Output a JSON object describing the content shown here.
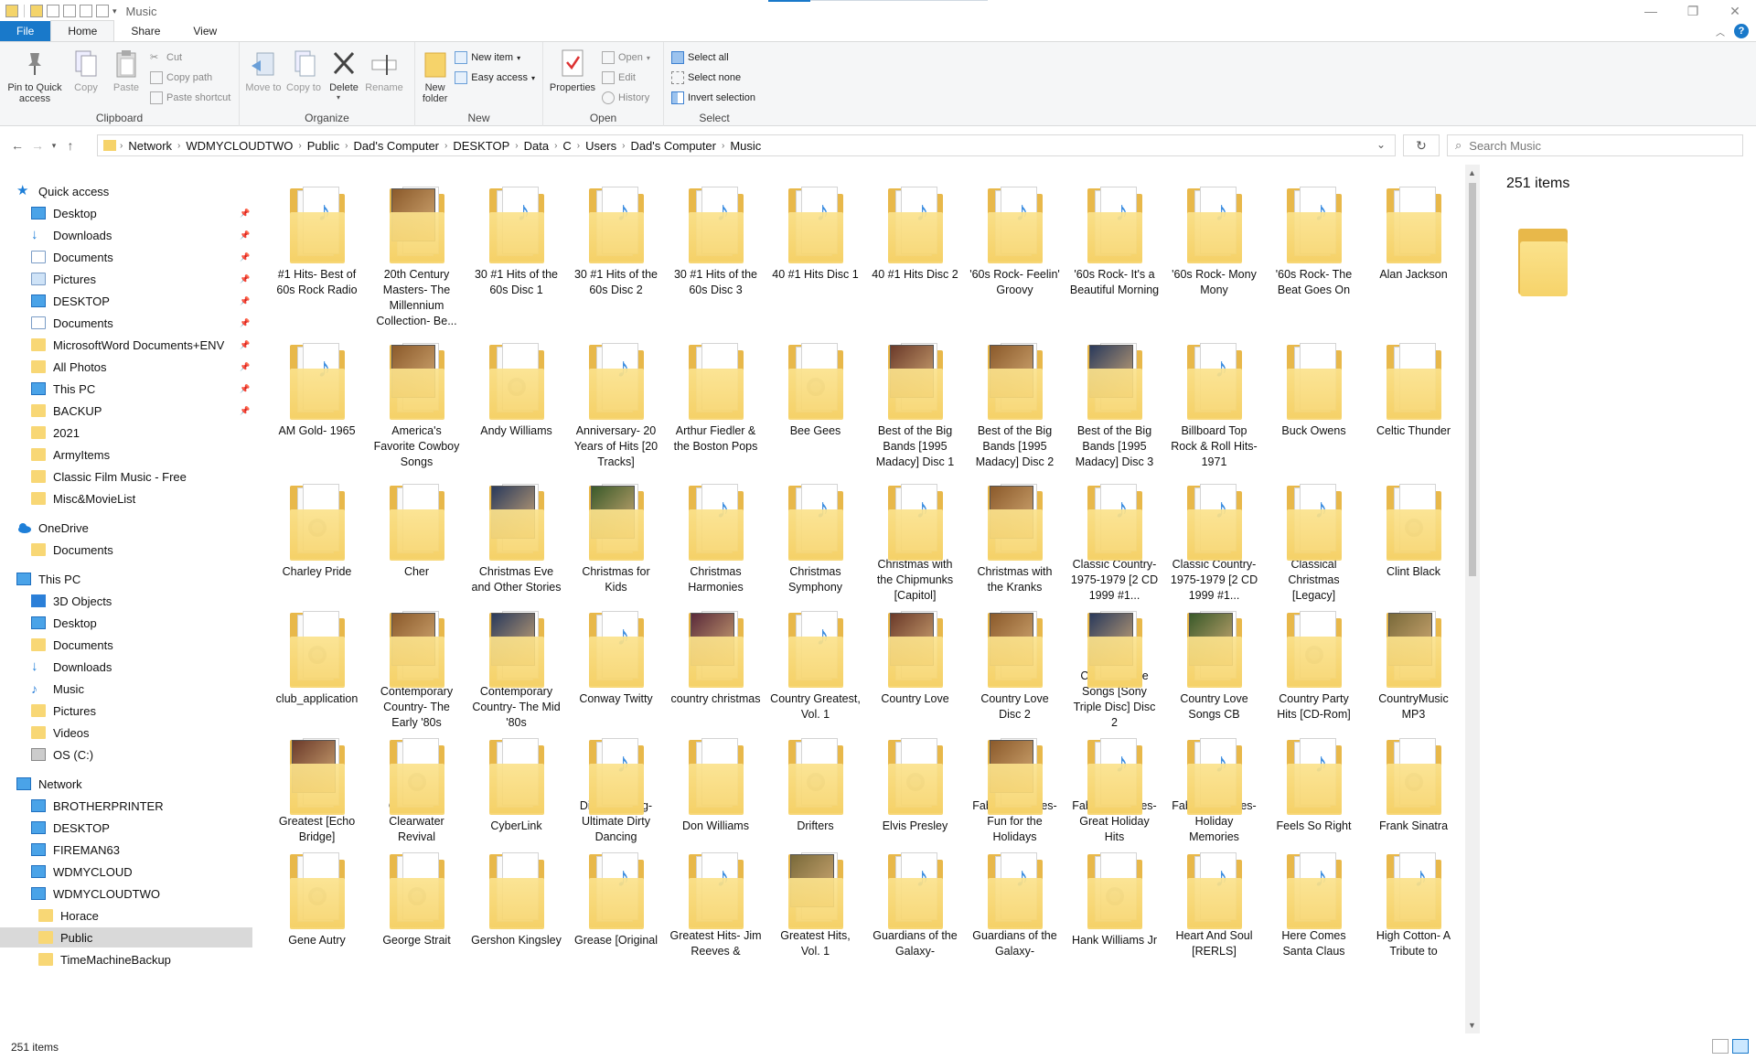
{
  "window": {
    "title": "Music",
    "controls": [
      "—",
      "❐",
      "✕"
    ]
  },
  "ribbon_tabs": [
    "File",
    "Home",
    "Share",
    "View"
  ],
  "ribbon": {
    "clipboard": {
      "label": "Clipboard",
      "pin": "Pin to Quick access",
      "copy": "Copy",
      "paste": "Paste",
      "cut": "Cut",
      "copy_path": "Copy path",
      "paste_shortcut": "Paste shortcut"
    },
    "organize": {
      "label": "Organize",
      "move_to": "Move to",
      "copy_to": "Copy to",
      "delete": "Delete",
      "rename": "Rename"
    },
    "new": {
      "label": "New",
      "new_folder": "New folder",
      "new_item": "New item",
      "easy_access": "Easy access"
    },
    "open": {
      "label": "Open",
      "properties": "Properties",
      "open": "Open",
      "edit": "Edit",
      "history": "History"
    },
    "select": {
      "label": "Select",
      "select_all": "Select all",
      "select_none": "Select none",
      "invert": "Invert selection"
    }
  },
  "address": {
    "crumbs": [
      "Network",
      "WDMYCLOUDTWO",
      "Public",
      "Dad's Computer",
      "DESKTOP",
      "Data",
      "C",
      "Users",
      "Dad's Computer",
      "Music"
    ],
    "search_placeholder": "Search Music"
  },
  "nav": {
    "quick_access": {
      "label": "Quick access",
      "items": [
        "Desktop",
        "Downloads",
        "Documents",
        "Pictures",
        "DESKTOP",
        "Documents",
        "MicrosoftWord Documents+ENV",
        "All Photos",
        "This PC",
        "BACKUP",
        "2021",
        "ArmyItems",
        "Classic Film Music - Free",
        "Misc&MovieList"
      ]
    },
    "onedrive": {
      "label": "OneDrive",
      "items": [
        "Documents"
      ]
    },
    "this_pc": {
      "label": "This PC",
      "items": [
        "3D Objects",
        "Desktop",
        "Documents",
        "Downloads",
        "Music",
        "Pictures",
        "Videos",
        "OS (C:)"
      ]
    },
    "network": {
      "label": "Network",
      "items": [
        "BROTHERPRINTER",
        "DESKTOP",
        "FIREMAN63",
        "WDMYCLOUD",
        "WDMYCLOUDTWO",
        "Horace",
        "Public",
        "TimeMachineBackup"
      ]
    }
  },
  "folders": [
    {
      "name": "#1 Hits- Best of 60s Rock Radio",
      "thumb": "mp3"
    },
    {
      "name": "20th Century Masters- The Millennium Collection- Be...",
      "thumb": "album"
    },
    {
      "name": "30 #1 Hits of the 60s Disc 1",
      "thumb": "mp3"
    },
    {
      "name": "30 #1 Hits of the 60s Disc 2",
      "thumb": "mp3"
    },
    {
      "name": "30 #1 Hits of the 60s Disc 3",
      "thumb": "mp3"
    },
    {
      "name": "40 #1 Hits Disc 1",
      "thumb": "wma"
    },
    {
      "name": "40 #1 Hits Disc 2",
      "thumb": "wma"
    },
    {
      "name": "'60s Rock- Feelin' Groovy",
      "thumb": "mp3"
    },
    {
      "name": "'60s Rock- It's a Beautiful Morning",
      "thumb": "mp3"
    },
    {
      "name": "'60s Rock- Mony Mony",
      "thumb": "mp3"
    },
    {
      "name": "'60s Rock- The Beat Goes On",
      "thumb": "mp3"
    },
    {
      "name": "Alan Jackson",
      "thumb": "plain"
    },
    {
      "name": "AM Gold- 1965",
      "thumb": "wma"
    },
    {
      "name": "America's Favorite Cowboy Songs",
      "thumb": "album"
    },
    {
      "name": "Andy Williams",
      "thumb": "gear"
    },
    {
      "name": "Anniversary- 20 Years of Hits [20 Tracks]",
      "thumb": "mp3"
    },
    {
      "name": "Arthur Fiedler & the Boston Pops",
      "thumb": "plain"
    },
    {
      "name": "Bee Gees",
      "thumb": "gear"
    },
    {
      "name": "Best of the Big Bands [1995 Madacy] Disc 1",
      "thumb": "album"
    },
    {
      "name": "Best of the Big Bands [1995 Madacy] Disc 2",
      "thumb": "album"
    },
    {
      "name": "Best of the Big Bands [1995 Madacy] Disc 3",
      "thumb": "album"
    },
    {
      "name": "Billboard Top Rock & Roll Hits- 1971",
      "thumb": "mp3"
    },
    {
      "name": "Buck Owens",
      "thumb": "plain"
    },
    {
      "name": "Celtic Thunder",
      "thumb": "plain"
    },
    {
      "name": "Charley Pride",
      "thumb": "gear"
    },
    {
      "name": "Cher",
      "thumb": "plain"
    },
    {
      "name": "Christmas Eve and Other Stories",
      "thumb": "album"
    },
    {
      "name": "Christmas for Kids",
      "thumb": "album"
    },
    {
      "name": "Christmas Harmonies",
      "thumb": "mp3"
    },
    {
      "name": "Christmas Symphony",
      "thumb": "mp3"
    },
    {
      "name": "Christmas with the Chipmunks [Capitol]",
      "thumb": "mp3"
    },
    {
      "name": "Christmas with the Kranks",
      "thumb": "album"
    },
    {
      "name": "Classic Country- 1975-1979 [2 CD 1999 #1...",
      "thumb": "mp3"
    },
    {
      "name": "Classic Country- 1975-1979 [2 CD 1999 #1...",
      "thumb": "mp3"
    },
    {
      "name": "Classical Christmas [Legacy]",
      "thumb": "mp3"
    },
    {
      "name": "Clint Black",
      "thumb": "gear"
    },
    {
      "name": "club_application",
      "thumb": "gear"
    },
    {
      "name": "Contemporary Country- The Early '80s",
      "thumb": "album"
    },
    {
      "name": "Contemporary Country- The Mid '80s",
      "thumb": "album"
    },
    {
      "name": "Conway Twitty",
      "thumb": "mp3"
    },
    {
      "name": "country christmas",
      "thumb": "album"
    },
    {
      "name": "Country Greatest, Vol. 1",
      "thumb": "mp3"
    },
    {
      "name": "Country Love",
      "thumb": "album"
    },
    {
      "name": "Country Love Disc 2",
      "thumb": "album"
    },
    {
      "name": "Country Love Songs [Sony Triple Disc] Disc 2",
      "thumb": "album"
    },
    {
      "name": "Country Love Songs CB",
      "thumb": "album"
    },
    {
      "name": "Country Party Hits [CD-Rom]",
      "thumb": "gear"
    },
    {
      "name": "CountryMusic MP3",
      "thumb": "album"
    },
    {
      "name": "Country's Greatest [Echo Bridge]",
      "thumb": "album"
    },
    {
      "name": "Creedence Clearwater Revival",
      "thumb": "gear"
    },
    {
      "name": "CyberLink",
      "thumb": "plain"
    },
    {
      "name": "Dirty Dancing- Ultimate Dirty Dancing",
      "thumb": "mp3"
    },
    {
      "name": "Don Williams",
      "thumb": "plain"
    },
    {
      "name": "Drifters",
      "thumb": "gear"
    },
    {
      "name": "Elvis Presley",
      "thumb": "gear"
    },
    {
      "name": "Fabulous Fifties- Fun for the Holidays",
      "thumb": "album"
    },
    {
      "name": "Fabulous Fifties- Great Holiday Hits",
      "thumb": "mp3"
    },
    {
      "name": "Fabulous Fifties- Holiday Memories",
      "thumb": "mp3"
    },
    {
      "name": "Feels So Right",
      "thumb": "mp3"
    },
    {
      "name": "Frank Sinatra",
      "thumb": "gear"
    },
    {
      "name": "Gene Autry",
      "thumb": "gear"
    },
    {
      "name": "George Strait",
      "thumb": "gear"
    },
    {
      "name": "Gershon Kingsley",
      "thumb": "plain"
    },
    {
      "name": "Grease [Original",
      "thumb": "mp3"
    },
    {
      "name": "Greatest Hits- Jim Reeves &",
      "thumb": "mp3"
    },
    {
      "name": "Greatest Hits, Vol. 1",
      "thumb": "album"
    },
    {
      "name": "Guardians of the Galaxy-",
      "thumb": "mp3"
    },
    {
      "name": "Guardians of the Galaxy-",
      "thumb": "mp3"
    },
    {
      "name": "Hank Williams Jr",
      "thumb": "gear"
    },
    {
      "name": "Heart And Soul [RERLS]",
      "thumb": "mp3"
    },
    {
      "name": "Here Comes Santa Claus",
      "thumb": "mp3"
    },
    {
      "name": "High Cotton- A Tribute to",
      "thumb": "mp3"
    }
  ],
  "details": {
    "count": "251 items"
  },
  "status": {
    "count": "251 items"
  },
  "colors": {
    "accent": "#1979ca",
    "folder": "#f6d36a",
    "folder_back": "#e8b84a",
    "note": "#3b8de0"
  }
}
